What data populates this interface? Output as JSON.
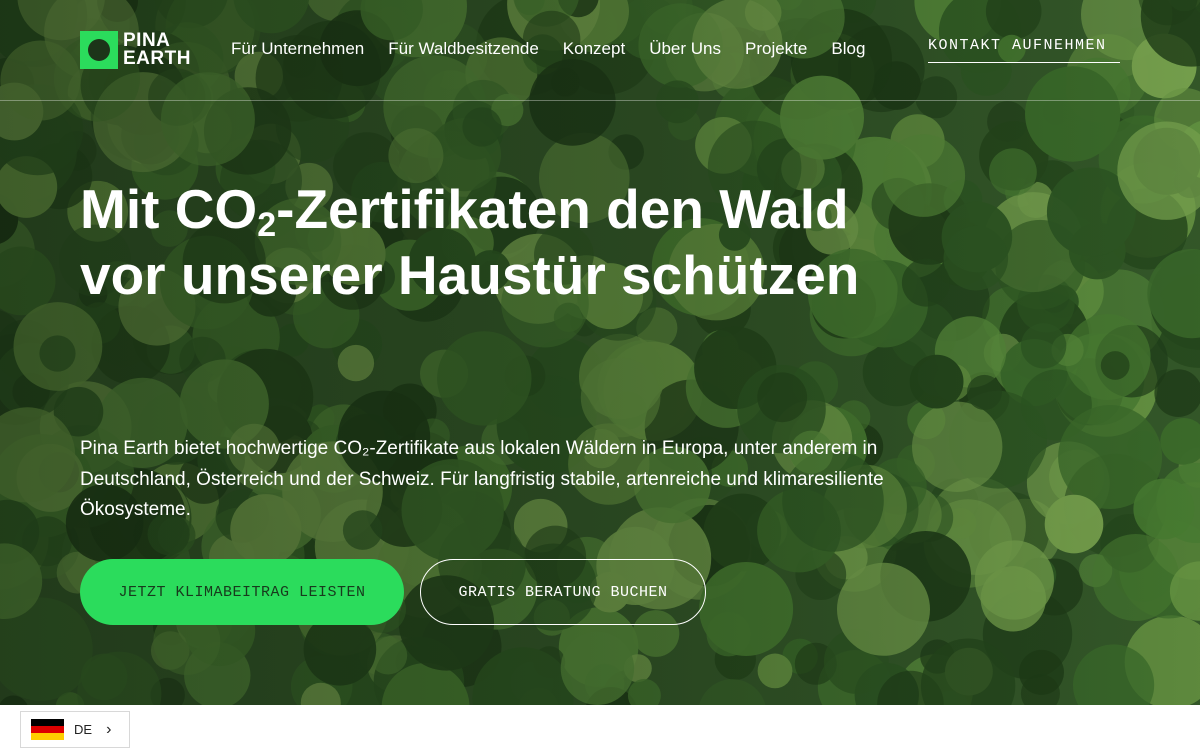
{
  "brand": {
    "line1": "PINA",
    "line2": "EARTH",
    "color": "#2bdc5c"
  },
  "nav": {
    "items": [
      {
        "label": "Für Unternehmen"
      },
      {
        "label": "Für Waldbesitzende"
      },
      {
        "label": "Konzept"
      },
      {
        "label": "Über Uns"
      },
      {
        "label": "Projekte"
      },
      {
        "label": "Blog"
      }
    ],
    "contact_label": "KONTAKT AUFNEHMEN"
  },
  "hero": {
    "heading_part1": "Mit CO",
    "heading_sub": "2",
    "heading_part2": "-Zertifikaten den Wald vor unserer Haustür schützen",
    "lead": "Pina Earth bietet hochwertige CO₂-Zertifikate aus lokalen Wäldern in Europa, unter anderem in Deutschland, Österreich und der Schweiz. Für langfristig stabile, artenreiche und klimaresiliente Ökosysteme.",
    "primary_cta": "JETZT KLIMABEITRAG LEISTEN",
    "secondary_cta": "GRATIS BERATUNG BUCHEN",
    "background": "forest-aerial-photo"
  },
  "language_switcher": {
    "code": "DE",
    "flag": "de-flag-icon",
    "chevron": "chevron-right-icon"
  }
}
